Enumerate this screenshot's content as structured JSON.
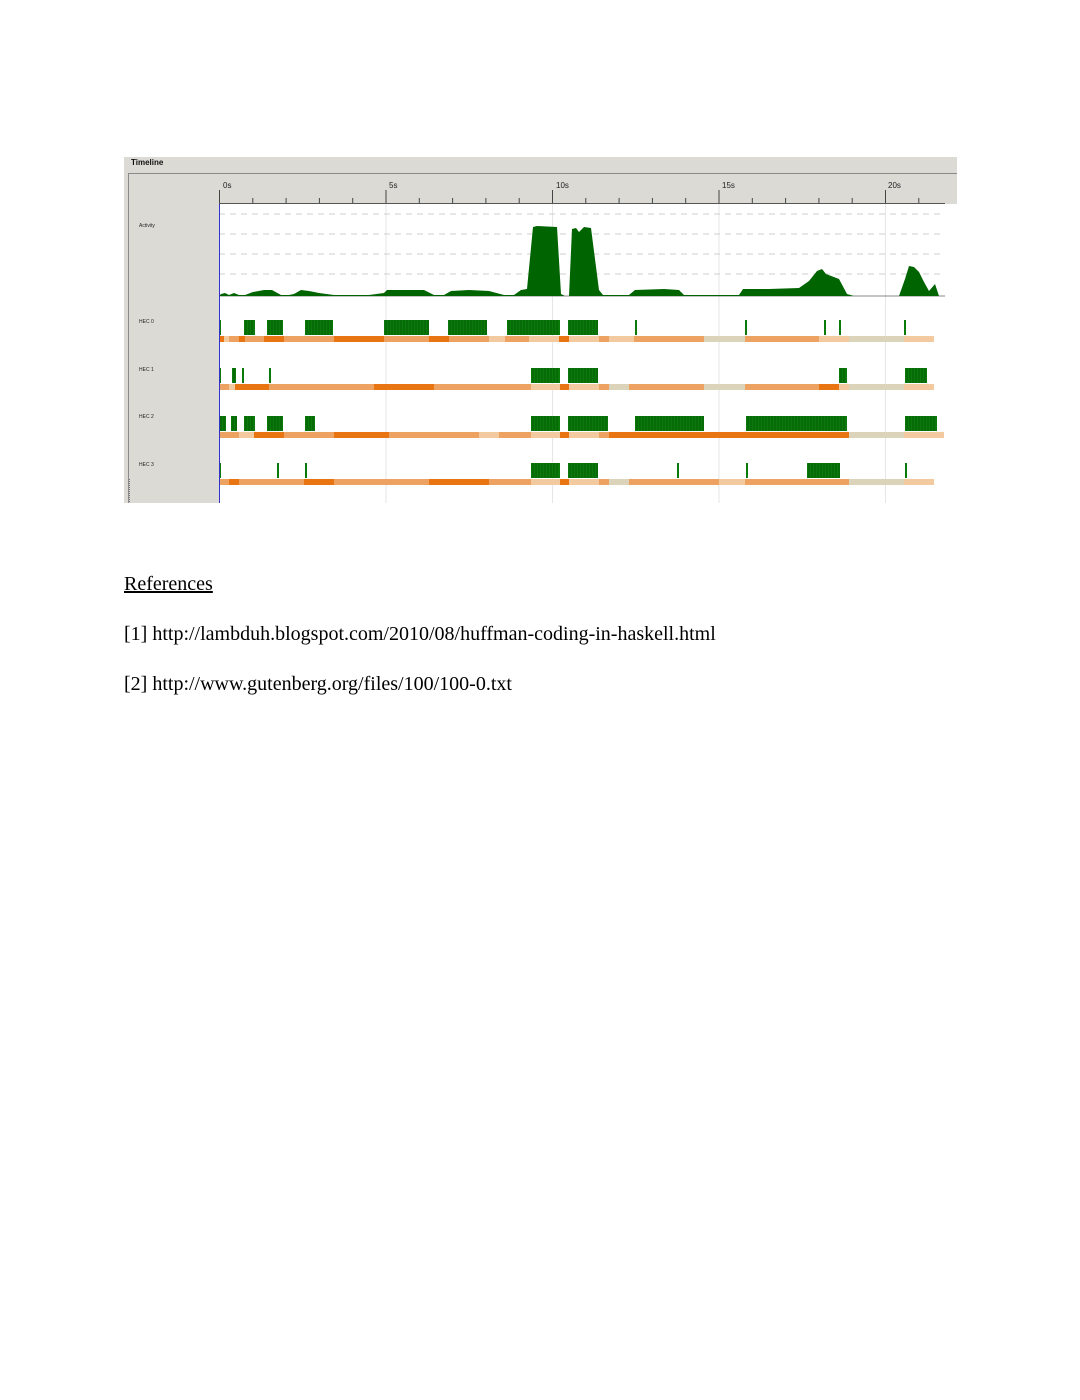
{
  "timeline": {
    "title": "Timeline",
    "ticks": [
      "0s",
      "5s",
      "10s",
      "15s",
      "20s"
    ],
    "rows": [
      "Activity",
      "HEC 0",
      "HEC 1",
      "HEC 2",
      "HEC 3"
    ],
    "colors": {
      "activity": "#006400",
      "running": "#0a7a0a",
      "gc_heavy": "#e87511",
      "gc_medium": "#eda261",
      "gc_light": "#f3c9a0",
      "idle": "#dcd3bb",
      "cursor": "#3333cc",
      "panel": "#dcdad5"
    }
  },
  "references": {
    "heading": "References",
    "items": [
      {
        "num": "[1]",
        "url": "http://lambduh.blogspot.com/2010/08/huffman-coding-in-haskell.html"
      },
      {
        "num": "[2]",
        "url": "http://www.gutenberg.org/files/100/100-0.txt"
      }
    ]
  }
}
